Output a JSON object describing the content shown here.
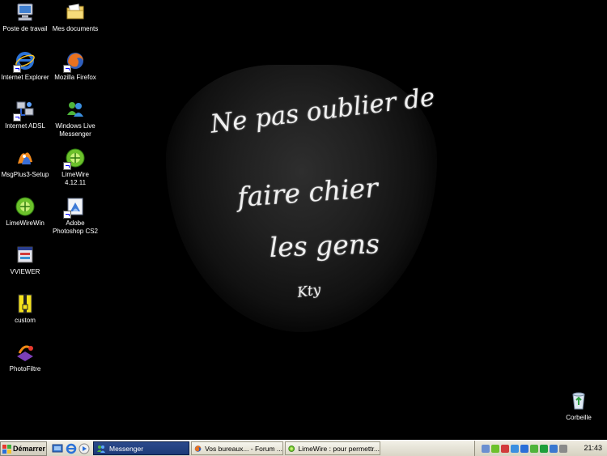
{
  "wallpaper": {
    "line1": "Ne pas oublier de",
    "line2": "faire chier",
    "line3": "les gens",
    "signature": "Kty"
  },
  "desktop_icons": [
    {
      "label": "Poste de travail",
      "icon": "computer-icon"
    },
    {
      "label": "Mes documents",
      "icon": "folder-icon"
    },
    {
      "label": "Internet Explorer",
      "icon": "internet-explorer-icon"
    },
    {
      "label": "Mozilla Firefox",
      "icon": "firefox-icon"
    },
    {
      "label": "Internet ADSL",
      "icon": "network-icon"
    },
    {
      "label": "Windows Live Messenger",
      "icon": "messenger-icon"
    },
    {
      "label": "MsgPlus3-Setup",
      "icon": "installer-icon"
    },
    {
      "label": "LimeWire 4.12.11",
      "icon": "limewire-icon"
    },
    {
      "label": "LimeWireWin",
      "icon": "limewire-icon"
    },
    {
      "label": "Adobe Photoshop CS2",
      "icon": "photoshop-icon"
    },
    {
      "label": "VVIEWER",
      "icon": "viewer-icon"
    },
    {
      "label": "custom",
      "icon": "zip-icon"
    },
    {
      "label": "PhotoFiltre",
      "icon": "photofiltre-icon"
    },
    {
      "label": "Corbeille",
      "icon": "recycle-bin-icon"
    }
  ],
  "taskbar": {
    "start_label": "Démarrer",
    "tasks": [
      {
        "label": "Messenger",
        "icon": "messenger-icon",
        "active": true
      },
      {
        "label": "Vos bureaux... - Forum ...",
        "icon": "firefox-icon",
        "active": false
      },
      {
        "label": "LimeWire : pour permettr...",
        "icon": "limewire-icon",
        "active": false
      }
    ],
    "clock": "21:43"
  },
  "colors": {
    "desktop_bg": "#000000",
    "taskbar_bg": "#ece9d8",
    "active_task": "#1d3a78"
  }
}
